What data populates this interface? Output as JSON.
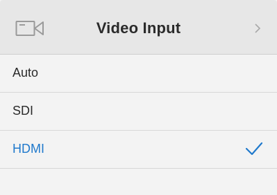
{
  "header": {
    "icon": "video-camera-icon",
    "title": "Video Input",
    "chevron_icon": "chevron-right-icon"
  },
  "options": [
    {
      "label": "Auto",
      "selected": false
    },
    {
      "label": "SDI",
      "selected": false
    },
    {
      "label": "HDMI",
      "selected": true
    }
  ],
  "colors": {
    "header_bg": "#e7e7e7",
    "panel_bg": "#f3f3f3",
    "accent": "#1f79cc",
    "text": "#2a2a2a",
    "divider": "#d7d7d7"
  }
}
